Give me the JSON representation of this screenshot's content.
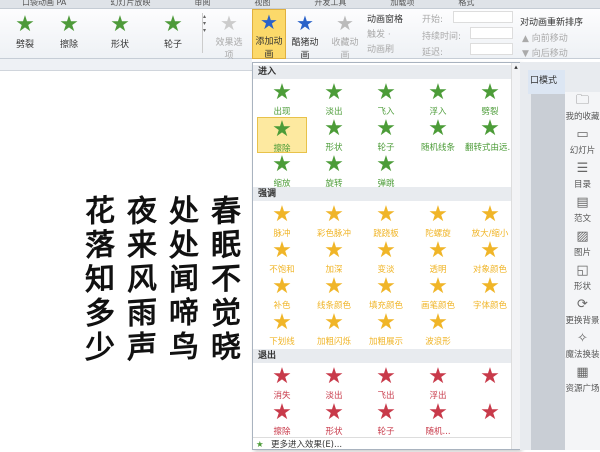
{
  "tabs": [
    "口袋动画 PA",
    "幻灯片放映",
    "审阅",
    "视图",
    "开发工具",
    "加载项",
    "格式"
  ],
  "gallery": [
    {
      "label": "劈裂",
      "icon": "star-split"
    },
    {
      "label": "擦除",
      "icon": "star-wipe"
    },
    {
      "label": "形状",
      "icon": "star-shape"
    },
    {
      "label": "轮子",
      "icon": "star-wheel"
    }
  ],
  "ribbon": {
    "effect_options": "效果选项",
    "add_animation": "添加动画",
    "painter": "酷猪动画",
    "favorite": "收藏动画",
    "anim_pane": "动画窗格",
    "trigger": "触发 ·",
    "anim_brush": "动画刷",
    "start": "开始:",
    "duration": "持续时间:",
    "delay": "延迟:",
    "reorder": "对动画重新排序",
    "move_earlier": "▲ 向前移动",
    "move_later": "▼ 向后移动"
  },
  "dropdown": {
    "enter_header": "进入",
    "enter": [
      "出现",
      "淡出",
      "飞入",
      "浮入",
      "劈裂",
      "擦除",
      "形状",
      "轮子",
      "随机线条",
      "翻转式由远...",
      "缩放",
      "旋转",
      "弹跳"
    ],
    "tooltip": "擦除",
    "emph_header": "强调",
    "emph": [
      "脉冲",
      "彩色脉冲",
      "跷跷板",
      "陀螺旋",
      "放大/缩小",
      "不饱和",
      "加深",
      "变淡",
      "透明",
      "对象颜色",
      "补色",
      "线条颜色",
      "填充颜色",
      "画笔颜色",
      "字体颜色",
      "下划线",
      "加粗闪烁",
      "加粗展示",
      "波浪形"
    ],
    "exit_header": "退出",
    "exit": [
      "消失",
      "淡出",
      "飞出",
      "浮出",
      "",
      "擦除",
      "形状",
      "轮子",
      "随机...",
      ""
    ],
    "more": "更多进入效果(E)..."
  },
  "right_pane": {
    "mode": "口模式",
    "items": [
      {
        "label": "我的收藏",
        "icon": "folder-heart"
      },
      {
        "label": "幻灯片",
        "icon": "slide"
      },
      {
        "label": "目录",
        "icon": "list"
      },
      {
        "label": "范文",
        "icon": "document"
      },
      {
        "label": "图片",
        "icon": "image"
      },
      {
        "label": "形状",
        "icon": "shape"
      },
      {
        "label": "更换背景",
        "icon": "refresh"
      },
      {
        "label": "魔法换装",
        "icon": "magic-wand"
      },
      {
        "label": "资源广场",
        "icon": "grid"
      }
    ]
  },
  "poem": [
    "春眠不觉晓",
    "处处闻啼鸟",
    "夜来风雨声",
    "花落知多少"
  ]
}
